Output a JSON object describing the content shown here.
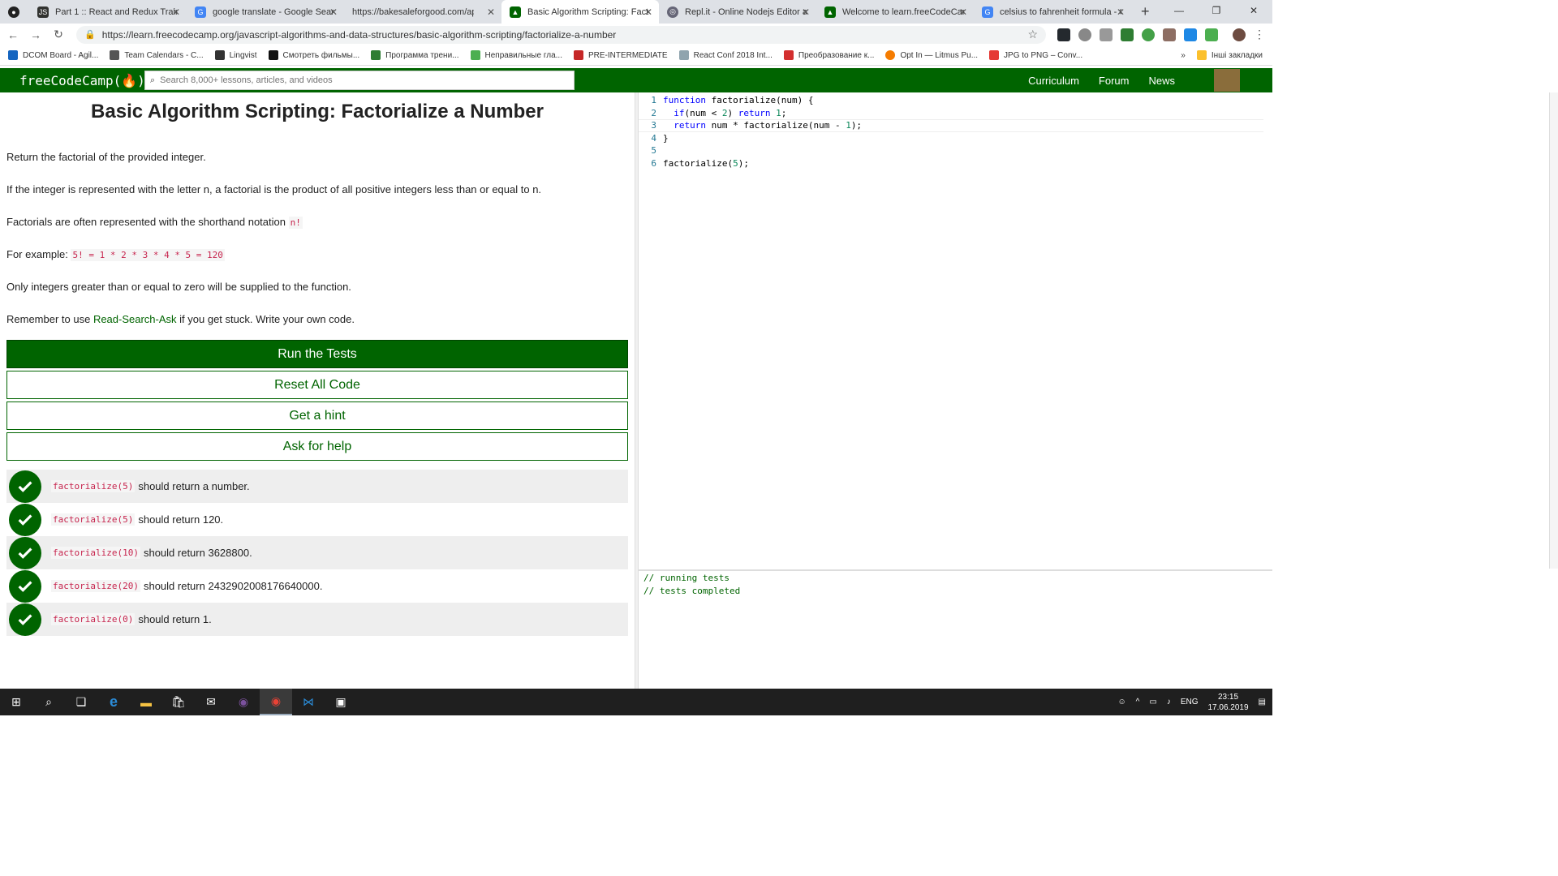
{
  "browser": {
    "tabs": [
      {
        "title": "",
        "icon": "github-icon"
      },
      {
        "title": "Part 1 :: React and Redux Training",
        "icon": "js-icon"
      },
      {
        "title": "google translate - Google Search",
        "icon": "google-icon"
      },
      {
        "title": "https://bakesaleforgood.com/api",
        "icon": "blank-icon"
      },
      {
        "title": "Basic Algorithm Scripting: Facto",
        "icon": "fcc-icon",
        "active": true
      },
      {
        "title": "Repl.it - Online Nodejs Editor an",
        "icon": "replit-icon"
      },
      {
        "title": "Welcome to learn.freeCodeCamp",
        "icon": "fcc-icon"
      },
      {
        "title": "celsius to fahrenheit formula - G",
        "icon": "google-icon"
      }
    ],
    "new_tab": "+",
    "url": "https://learn.freecodecamp.org/javascript-algorithms-and-data-structures/basic-algorithm-scripting/factorialize-a-number",
    "bookmarks": [
      "DCOM Board - Agil...",
      "Team Calendars - C...",
      "Lingvist",
      "Смотреть фильмы...",
      "Программа трени...",
      "Неправильные гла...",
      "PRE-INTERMEDIATE",
      "React Conf 2018 Int...",
      "Преобразование к...",
      "Opt In — Litmus Pu...",
      "JPG to PNG – Conv..."
    ],
    "other_bookmarks": "Інші закладки",
    "more_bookmarks": "»"
  },
  "fcc": {
    "logo": "freeCodeCamp(🔥)",
    "search_placeholder": "Search 8,000+ lessons, articles, and videos",
    "nav": [
      "Curriculum",
      "Forum",
      "News"
    ]
  },
  "challenge": {
    "title": "Basic Algorithm Scripting: Factorialize a Number",
    "p1": "Return the factorial of the provided integer.",
    "p2": "If the integer is represented with the letter n, a factorial is the product of all positive integers less than or equal to n.",
    "p3_text": "Factorials are often represented with the shorthand notation ",
    "p3_code": "n!",
    "p4_text": "For example: ",
    "p4_code": "5! = 1 * 2 * 3 * 4 * 5 = 120",
    "p5": "Only integers greater than or equal to zero will be supplied to the function.",
    "p6_pre": "Remember to use ",
    "p6_link": "Read-Search-Ask",
    "p6_post": " if you get stuck. Write your own code.",
    "buttons": {
      "run": "Run the Tests",
      "reset": "Reset All Code",
      "hint": "Get a hint",
      "help": "Ask for help"
    },
    "tests": [
      {
        "code": "factorialize(5)",
        "text": "should return a number."
      },
      {
        "code": "factorialize(5)",
        "text": "should return 120."
      },
      {
        "code": "factorialize(10)",
        "text": "should return 3628800."
      },
      {
        "code": "factorialize(20)",
        "text": "should return 2432902008176640000."
      },
      {
        "code": "factorialize(0)",
        "text": "should return 1."
      }
    ]
  },
  "editor": {
    "line_numbers": [
      "1",
      "2",
      "3",
      "4",
      "5",
      "6"
    ]
  },
  "console": {
    "lines": [
      "// running tests",
      "// tests completed"
    ]
  },
  "taskbar": {
    "lang": "ENG",
    "time": "23:15",
    "date": "17.06.2019"
  },
  "colors": {
    "brand": "#006400",
    "code": "#c7254e"
  }
}
